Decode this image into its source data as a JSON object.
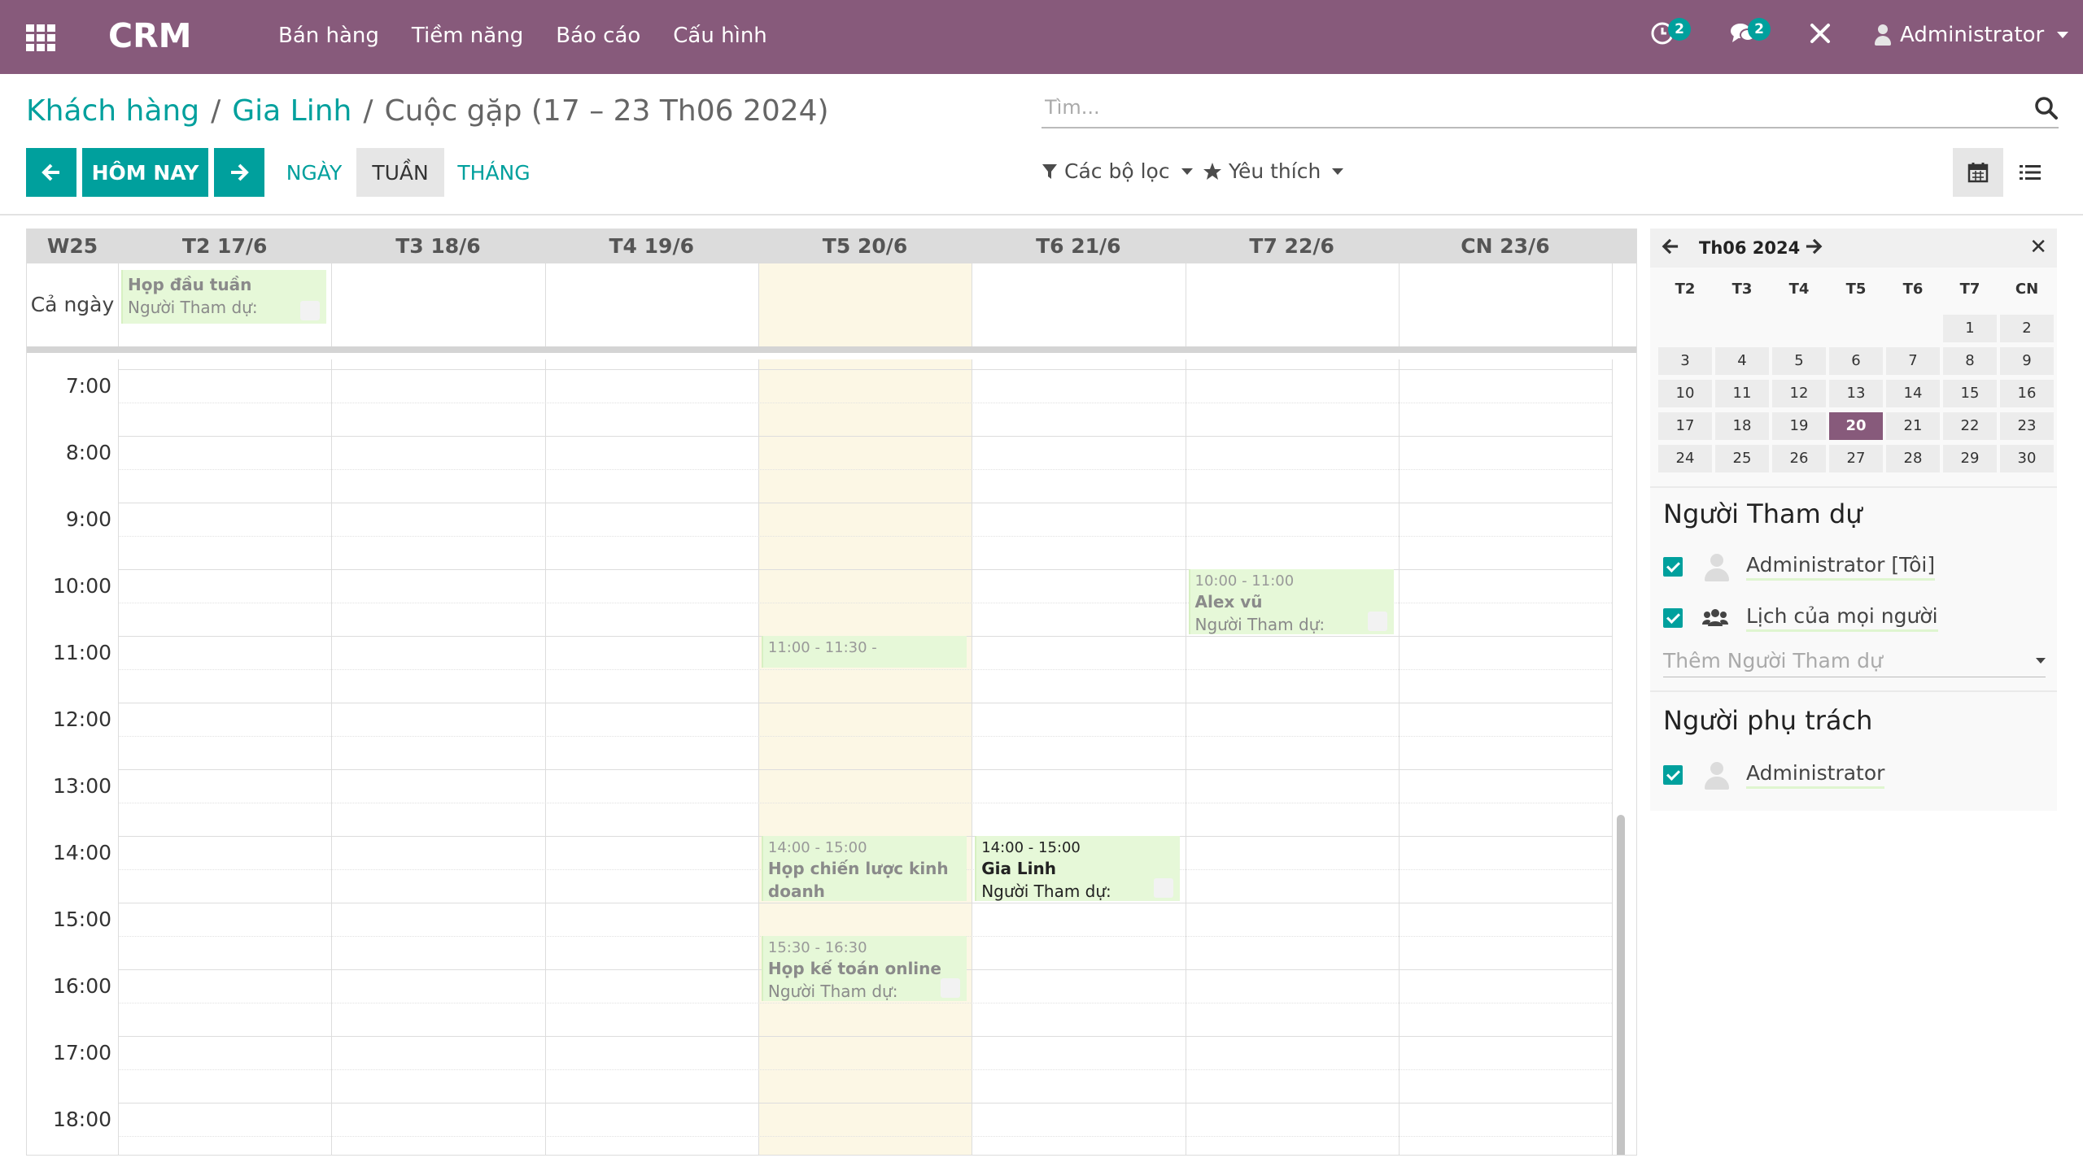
{
  "navbar": {
    "brand": "CRM",
    "menu": [
      "Bán hàng",
      "Tiềm năng",
      "Báo cáo",
      "Cấu hình"
    ],
    "activity_badge": "2",
    "messages_badge": "2",
    "user_name": "Administrator"
  },
  "breadcrumb": {
    "items": [
      "Khách hàng",
      "Gia Linh"
    ],
    "separator": "/",
    "current": "Cuộc gặp (17 – 23 Th06 2024)"
  },
  "search": {
    "placeholder": "Tìm..."
  },
  "toolbar": {
    "today_label": "HÔM NAY",
    "day_label": "NGÀY",
    "week_label": "TUẦN",
    "month_label": "THÁNG",
    "filters_label": "Các bộ lọc",
    "favorites_label": "Yêu thích"
  },
  "calendar": {
    "week_label": "W25",
    "days": [
      "T2 17/6",
      "T3 18/6",
      "T4 19/6",
      "T5 20/6",
      "T6 21/6",
      "T7 22/6",
      "CN 23/6"
    ],
    "today_index": 3,
    "allday_label": "Cả ngày",
    "hours": [
      "7:00",
      "8:00",
      "9:00",
      "10:00",
      "11:00",
      "12:00",
      "13:00",
      "14:00",
      "15:00",
      "16:00",
      "17:00",
      "18:00"
    ],
    "allday_event": {
      "day": 0,
      "title": "Họp đầu tuần",
      "subtitle": "Người Tham dự:"
    },
    "events": [
      {
        "day": 5,
        "start": 10.0,
        "end": 11.0,
        "time": "10:00 - 11:00",
        "title": "Alex vũ",
        "subtitle": "Người Tham dự:",
        "style": "light"
      },
      {
        "day": 3,
        "start": 11.0,
        "end": 11.5,
        "time": "11:00 - 11:30 -",
        "title": "",
        "subtitle": "",
        "style": "light"
      },
      {
        "day": 3,
        "start": 14.0,
        "end": 15.0,
        "time": "14:00 - 15:00",
        "title": "Họp chiến lược kinh doanh",
        "subtitle": "",
        "style": "light"
      },
      {
        "day": 4,
        "start": 14.0,
        "end": 15.0,
        "time": "14:00 - 15:00",
        "title": "Gia Linh",
        "subtitle": "Người Tham dự:",
        "style": "dark"
      },
      {
        "day": 3,
        "start": 15.5,
        "end": 16.5,
        "time": "15:30 - 16:30",
        "title": "Họp kế toán online",
        "subtitle": "Người Tham dự:",
        "style": "light"
      }
    ]
  },
  "mini_calendar": {
    "title": "Th06 2024",
    "dow": [
      "T2",
      "T3",
      "T4",
      "T5",
      "T6",
      "T7",
      "CN"
    ],
    "first_weekday_index": 5,
    "days_in_month": 30,
    "selected_day": 20
  },
  "sidebar": {
    "attendees_title": "Người Tham dự",
    "attendees": [
      "Administrator [Tôi]",
      "Lịch của mọi người"
    ],
    "add_attendee_placeholder": "Thêm Người Tham dự",
    "owner_title": "Người phụ trách",
    "owners": [
      "Administrator"
    ]
  },
  "colors": {
    "navbar": "#875a7b",
    "primary": "#00a09d",
    "today_column": "#fcf7e5",
    "event_bg": "#e6f8d8"
  }
}
